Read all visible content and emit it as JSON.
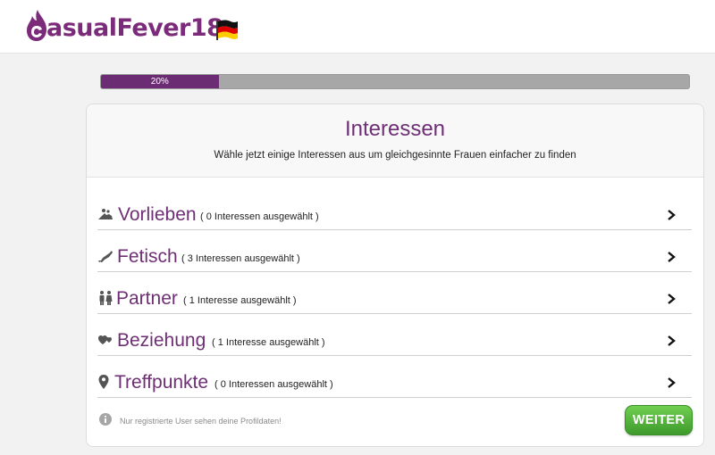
{
  "header": {
    "logo_text": "asualFever18",
    "logo_full": "CasualFever18"
  },
  "progress": {
    "label": "20%",
    "value": 0.2
  },
  "card": {
    "title": "Interessen",
    "subtitle": "Wähle jetzt einige Interessen aus um gleichgesinnte Frauen einfacher zu finden",
    "rows": [
      {
        "title": "Vorlieben",
        "count": "( 0 Interessen ausgewählt )",
        "icon": "couple-position-icon"
      },
      {
        "title": "Fetisch",
        "count": "( 3 Interessen ausgewählt )",
        "icon": "high-heel-icon"
      },
      {
        "title": "Partner",
        "count": "( 1 Interesse ausgewählt )",
        "icon": "people-icon"
      },
      {
        "title": "Beziehung",
        "count": "( 1 Interesse ausgewählt )",
        "icon": "hearts-icon"
      },
      {
        "title": "Treffpunkte",
        "count": "( 0 Interessen ausgewählt )",
        "icon": "map-marker-icon"
      }
    ],
    "info": "Nur registrierte User sehen deine Profildaten!",
    "button": "WEITER"
  },
  "colors": {
    "brand": "#6e2f75",
    "progress": "#6b2c73",
    "button": "#4caf35"
  }
}
